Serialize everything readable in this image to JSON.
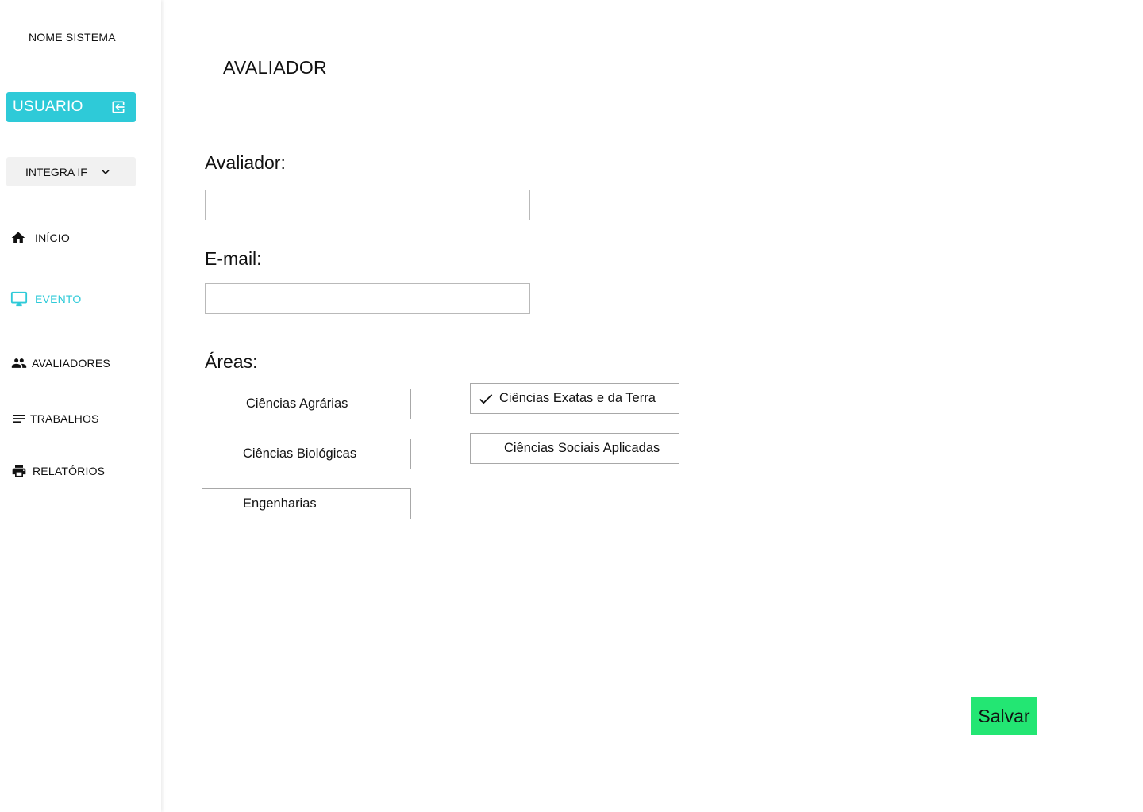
{
  "sidebar": {
    "system_name": "NOME SISTEMA",
    "user_button": {
      "label": "USUARIO",
      "icon": "logout-icon"
    },
    "event_select": {
      "selected": "INTEGRA IF",
      "icon": "chevron-down-icon"
    },
    "nav": [
      {
        "label": "INÍCIO",
        "icon": "home-icon",
        "active": false
      },
      {
        "label": "EVENTO",
        "icon": "monitor-icon",
        "active": true
      },
      {
        "label": "AVALIADORES",
        "icon": "people-icon",
        "active": false
      },
      {
        "label": "TRABALHOS",
        "icon": "list-icon",
        "active": false
      },
      {
        "label": "RELATÓRIOS",
        "icon": "printer-icon",
        "active": false
      }
    ]
  },
  "main": {
    "title": "AVALIADOR",
    "form": {
      "avaliador_label": "Avaliador:",
      "avaliador_value": "",
      "email_label": "E-mail:",
      "email_value": "",
      "areas_label": "Áreas:"
    },
    "areas": [
      {
        "label": "Ciências Agrárias",
        "checked": false
      },
      {
        "label": "Ciências Biológicas",
        "checked": false
      },
      {
        "label": "Engenharias",
        "checked": false
      },
      {
        "label": "Ciências Exatas e da Terra",
        "checked": true
      },
      {
        "label": "Ciências Sociais Aplicadas",
        "checked": false
      }
    ],
    "save_label": "Salvar"
  },
  "colors": {
    "accent": "#2ECAD8",
    "save": "#23E673",
    "select_bg": "#F1F1F1"
  }
}
